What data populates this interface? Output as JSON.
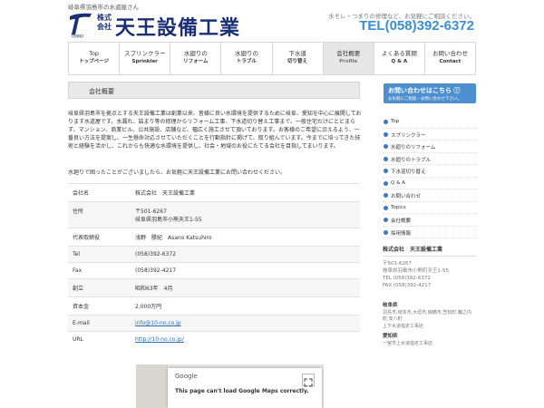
{
  "header": {
    "tagline": "岐阜県羽島市の水道屋さん",
    "logo_small": "株式会社",
    "logo_name": "天王設備工業",
    "note": "水モレ・つまりの修理など、お気軽にご相談ください。",
    "phone": "TEL(058)392-6372"
  },
  "nav": [
    {
      "main": "Top",
      "sub": "トップページ"
    },
    {
      "main": "スプリンクラー",
      "sub": "Sprinkler"
    },
    {
      "main": "水廻りの",
      "sub": "リフォーム"
    },
    {
      "main": "水廻りの",
      "sub": "トラブル"
    },
    {
      "main": "下水道",
      "sub": "切り替え"
    },
    {
      "main": "会社概要",
      "sub": "Profile"
    },
    {
      "main": "よくある質問",
      "sub": "Q & A"
    },
    {
      "main": "お問い合わせ",
      "sub": "Contact"
    }
  ],
  "main": {
    "heading": "会社概要",
    "intro": "岐阜県羽島市を拠点とする天王設備工業は創業以来、皆様に良い水環境を提供するために岐阜、愛知を中心に展開しております水道屋です。水漏れ、詰まり等の修理からリフォーム工事、下水道切り替え工事まで、一般住宅だけにとどまらず、マンション、商業ビル、公共施設、店舗など、幅広く施工させて頂いております。お客様のご希望に沿えるよう、一番良い方法を提案し、一生懸命対応させていただくことを行動指針に掲げて、取り組んでいます。今までに培ってきた技術と経験を活かし、これからも快適な水環境を提供し、社会・地域のお役にたてる会社を目指してまいります。",
    "intro2": "水廻りで困ったことがございましたら、お気軽に天王設備工業にお問い合わせください。",
    "rows": [
      {
        "k": "会社名",
        "v": "株式会社　天王設備工業"
      },
      {
        "k": "住所",
        "v": "〒501-6267\n岐阜県羽島市小熊天王1-55"
      },
      {
        "k": "代表取締役",
        "v": "浅野　勝紀　Asano Katsuhiro"
      },
      {
        "k": "Tel",
        "v": "(058)392-6372"
      },
      {
        "k": "Fax",
        "v": "(058)392-4217"
      },
      {
        "k": "創立",
        "v": "昭和63年　4月"
      },
      {
        "k": "資本金",
        "v": "2,000万円"
      },
      {
        "k": "E-mail",
        "v": "info@10-no.co.jp",
        "link": true
      },
      {
        "k": "URL",
        "v": "http://10-no.co.jp/",
        "link": true
      }
    ],
    "map": {
      "brand": "Google",
      "error": "This page can't load Google Maps correctly."
    }
  },
  "sidebar": {
    "cta_main": "お問い合わせはこちら ⓘ",
    "cta_sub": "お気軽にご相談・お問い合わせ下さい。",
    "links": [
      "Top",
      "スプリンクラー",
      "水廻りのリフォーム",
      "水廻りのトラブル",
      "下水道切り替え",
      "Q & A",
      "お問い合わせ",
      "Topics",
      "会社概要",
      "採用情報"
    ],
    "company": {
      "title": "株式会社　天王設備工業",
      "zip": "〒501-6267",
      "address": "岐阜県羽島市小熊町天王1-55",
      "tel": "TEL (058)392-6372",
      "fax": "FAX (058)392-4217"
    },
    "area1_title": "岐阜県",
    "area1_text": "羽島市,岐阜市,大垣市,瑞穂市,笠松町,輪之内町,安八町\n上下水道指定工事店",
    "area2_title": "愛知県",
    "area2_text": "一宮市上水道指定工事店"
  },
  "colors": {
    "brand": "#1a2f74",
    "accent": "#3a8ed4",
    "cta": "#4d8fcf"
  }
}
